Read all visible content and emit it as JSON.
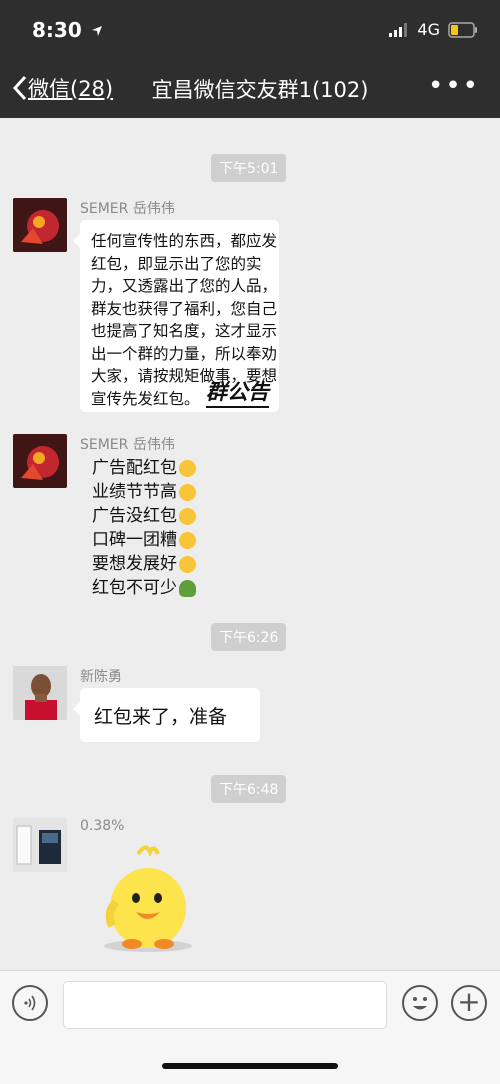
{
  "status_bar": {
    "time": "8:30",
    "network": "4G"
  },
  "nav": {
    "back_label": "微信(28)",
    "title": "宜昌微信交友群1(102)",
    "more_label": "•••"
  },
  "messages": [
    {
      "time": "下午5:01",
      "sender": "SEMER 岳伟伟",
      "text": "任何宣传性的东西，都应发红包，即显示出了您的实力，又透露出了您的人品，群友也获得了福利，您自己也提高了知名度，这才显示出一个群的力量，所以奉劝大家，请按规矩做事，要想宣传先发红包。",
      "signature": "群公告"
    },
    {
      "sender": "SEMER 岳伟伟",
      "lines": [
        "广告配红包",
        "业绩节节高",
        "广告没红包",
        "口碑一团糟",
        "要想发展好",
        "红包不可少"
      ]
    },
    {
      "time": "下午6:26",
      "sender": "新陈勇",
      "text": "红包来了，准备"
    },
    {
      "time": "下午6:48",
      "sender": "0.38%",
      "sticker": "yellow-duck-sticker"
    }
  ],
  "icons": [
    "back-chevron-icon",
    "more-icon",
    "voice-icon",
    "emoji-icon",
    "plus-icon",
    "signal-icon",
    "battery-icon",
    "location-arrow-icon"
  ],
  "colors": {
    "header": "#2e2e2e",
    "chat_bg": "#ededed",
    "bubble": "#ffffff",
    "time_pill": "#cfcfcf"
  }
}
